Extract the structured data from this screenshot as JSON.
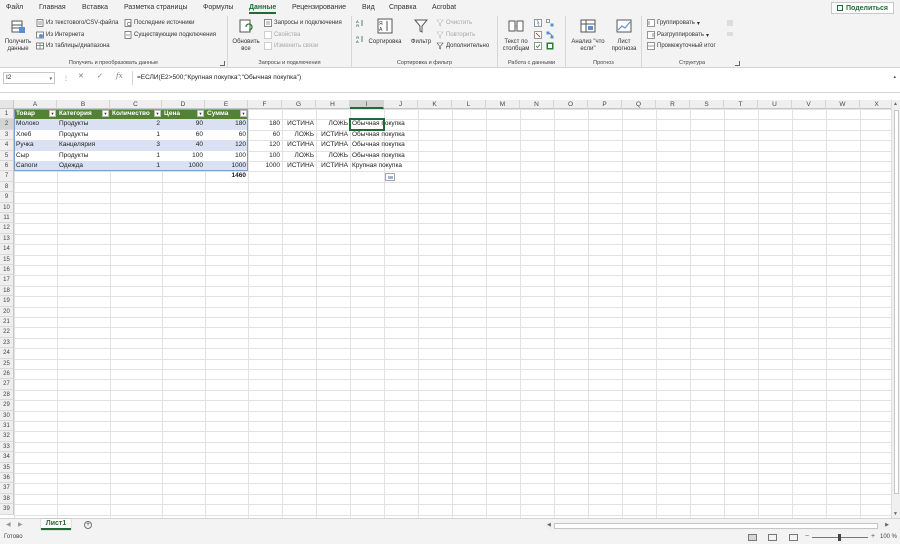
{
  "menu": {
    "tabs": [
      "Файл",
      "Главная",
      "Вставка",
      "Разметка страницы",
      "Формулы",
      "Данные",
      "Рецензирование",
      "Вид",
      "Справка",
      "Acrobat"
    ],
    "active": "Данные",
    "share_label": "Поделиться"
  },
  "ribbon": {
    "get_data": {
      "big_label": "Получить данные",
      "from_text": "Из текстового/CSV-файла",
      "from_web": "Из Интернета",
      "from_table": "Из таблицы/диапазона",
      "recent": "Последние источники",
      "existing": "Существующие подключения",
      "group_label": "Получить и преобразовать данные"
    },
    "queries": {
      "refresh_label": "Обновить все",
      "queries_conn": "Запросы и подключения",
      "properties": "Свойства",
      "edit_links": "Изменить связи",
      "group_label": "Запросы и подключения"
    },
    "sort_filter": {
      "sort": "Сортировка",
      "filter": "Фильтр",
      "clear": "Очистить",
      "reapply": "Повторить",
      "advanced": "Дополнительно",
      "group_label": "Сортировка и фильтр"
    },
    "data_tools": {
      "text_to_columns": "Текст по столбцам",
      "group_label": "Работа с данными"
    },
    "forecast": {
      "what_if": "Анализ \"что если\"",
      "forecast_sheet": "Лист прогноза",
      "group_label": "Прогноз"
    },
    "outline": {
      "group": "Группировать",
      "ungroup": "Разгруппировать",
      "subtotal": "Промежуточный итог",
      "group_label": "Структура"
    }
  },
  "formula_bar": {
    "name_box": "I2",
    "formula": "=ЕСЛИ(E2>500;\"Крупная покупка\";\"Обычная покупка\")",
    "cancel": "✕",
    "enter": "✓",
    "fx": "fx"
  },
  "sheet": {
    "columns": [
      "A",
      "B",
      "C",
      "D",
      "E",
      "F",
      "G",
      "H",
      "I",
      "J",
      "K",
      "L",
      "M",
      "N",
      "O",
      "P",
      "Q",
      "R",
      "S",
      "T",
      "U",
      "V",
      "W",
      "X"
    ],
    "selected_column": "I",
    "row_count": 39,
    "selected_row": 2,
    "table_headers": [
      "Товар",
      "Категория",
      "Количество",
      "Цена",
      "Сумма"
    ],
    "table_rows": [
      [
        "Молоко",
        "Продукты",
        "2",
        "90",
        "180"
      ],
      [
        "Хлеб",
        "Продукты",
        "1",
        "60",
        "60"
      ],
      [
        "Ручка",
        "Канцелярия",
        "3",
        "40",
        "120"
      ],
      [
        "Сыр",
        "Продукты",
        "1",
        "100",
        "100"
      ],
      [
        "Сапоги",
        "Одежда",
        "1",
        "1000",
        "1000"
      ]
    ],
    "total": "1460",
    "extra_rows": [
      [
        "180",
        "ИСТИНА",
        "ЛОЖЬ",
        "Обычная покупка"
      ],
      [
        "60",
        "ЛОЖЬ",
        "ИСТИНА",
        "Обычная покупка"
      ],
      [
        "120",
        "ИСТИНА",
        "ИСТИНА",
        "Обычная покупка"
      ],
      [
        "100",
        "ЛОЖЬ",
        "ЛОЖЬ",
        "Обычная покупка"
      ],
      [
        "1000",
        "ИСТИНА",
        "ИСТИНА",
        "Крупная покупка"
      ]
    ]
  },
  "tabs": {
    "sheet_name": "Лист1"
  },
  "status": {
    "text": "Готово",
    "zoom": "100 %"
  },
  "colors": {
    "accent": "#1e6b35",
    "table_header": "#548235",
    "table_band": "#d9e1f2"
  }
}
